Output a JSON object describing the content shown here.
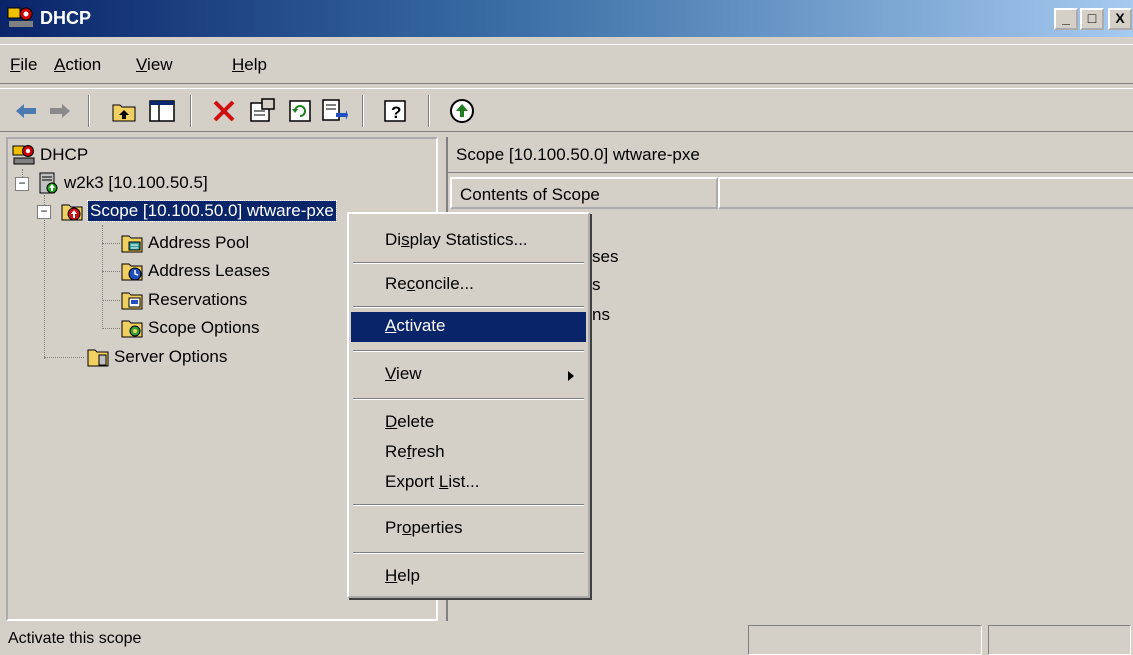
{
  "window": {
    "title": "DHCP"
  },
  "menu": [
    {
      "label": "File",
      "accel": "F",
      "rest": "ile"
    },
    {
      "label": "Action",
      "accel": "A",
      "rest": "ction"
    },
    {
      "label": "View",
      "accel": "V",
      "rest": "iew"
    },
    {
      "label": "Help",
      "accel": "H",
      "rest": "elp"
    }
  ],
  "toolbar": [
    "back-icon",
    "forward-icon",
    "up-one-level-icon",
    "show-hide-tree-icon",
    "delete-icon",
    "properties-icon",
    "refresh-icon",
    "export-list-icon",
    "help-icon",
    "activate-scope-icon"
  ],
  "tree": {
    "root": "DHCP",
    "server": "w2k3 [10.100.50.5]",
    "scope": "Scope [10.100.50.0] wtware-pxe",
    "scope_children": [
      "Address Pool",
      "Address Leases",
      "Reservations",
      "Scope Options"
    ],
    "server_options": "Server Options"
  },
  "right_pane": {
    "header": "Scope [10.100.50.0] wtware-pxe",
    "column_header": "Contents of Scope",
    "visible_fragments": [
      "ses",
      "s",
      "ns"
    ]
  },
  "context_menu": {
    "items": [
      {
        "pre": "Di",
        "accel": "s",
        "post": "play Statistics..."
      },
      {
        "pre": "Re",
        "accel": "c",
        "post": "oncile..."
      },
      {
        "pre": "",
        "accel": "A",
        "post": "ctivate",
        "highlighted": true
      },
      {
        "pre": "",
        "accel": "V",
        "post": "iew",
        "submenu": true
      },
      {
        "pre": "",
        "accel": "D",
        "post": "elete"
      },
      {
        "pre": "Re",
        "accel": "f",
        "post": "resh"
      },
      {
        "pre": "Export ",
        "accel": "L",
        "post": "ist..."
      },
      {
        "pre": "Pr",
        "accel": "o",
        "post": "perties"
      },
      {
        "pre": "",
        "accel": "H",
        "post": "elp"
      }
    ]
  },
  "status": {
    "text": "Activate this scope"
  },
  "colors": {
    "selection": "#0a246a",
    "titlebar_start": "#0a246a",
    "titlebar_end": "#a6caf0",
    "face": "#d4d0c8"
  }
}
